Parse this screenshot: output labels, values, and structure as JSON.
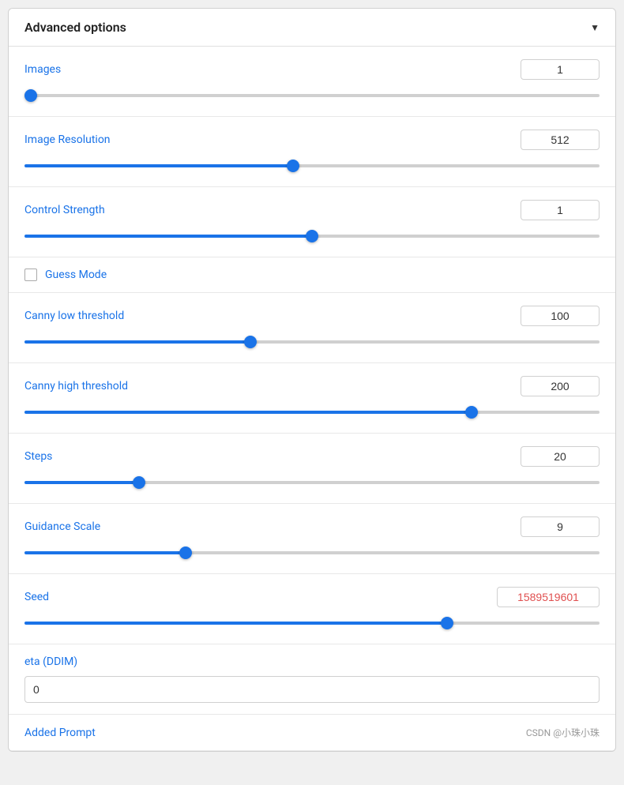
{
  "header": {
    "title": "Advanced options",
    "arrow": "▼"
  },
  "fields": {
    "images": {
      "label": "Images",
      "value": "1",
      "slider_percent": 2,
      "min": 1,
      "max": 10,
      "current": 1
    },
    "image_resolution": {
      "label": "Image Resolution",
      "value": "512",
      "slider_percent": 50,
      "min": 64,
      "max": 1024,
      "current": 512
    },
    "control_strength": {
      "label": "Control Strength",
      "value": "1",
      "slider_percent": 50,
      "min": 0,
      "max": 2,
      "current": 1
    },
    "guess_mode": {
      "label": "Guess Mode",
      "checked": false
    },
    "canny_low": {
      "label": "Canny low threshold",
      "value": "100",
      "slider_percent": 37,
      "min": 1,
      "max": 255,
      "current": 100
    },
    "canny_high": {
      "label": "Canny high threshold",
      "value": "200",
      "slider_percent": 74,
      "min": 1,
      "max": 255,
      "current": 200
    },
    "steps": {
      "label": "Steps",
      "value": "20",
      "slider_percent": 18,
      "min": 1,
      "max": 100,
      "current": 20
    },
    "guidance_scale": {
      "label": "Guidance Scale",
      "value": "9",
      "slider_percent": 26,
      "min": 1,
      "max": 30,
      "current": 9
    },
    "seed": {
      "label": "Seed",
      "value": "1589519601",
      "slider_percent": 70,
      "min": -1,
      "max": 2147483647,
      "current": 1589519601
    },
    "eta": {
      "label": "eta (DDIM)",
      "value": "0",
      "placeholder": "0"
    },
    "added_prompt": {
      "label": "Added Prompt"
    }
  },
  "watermark": "CSDN @小珠小珠"
}
